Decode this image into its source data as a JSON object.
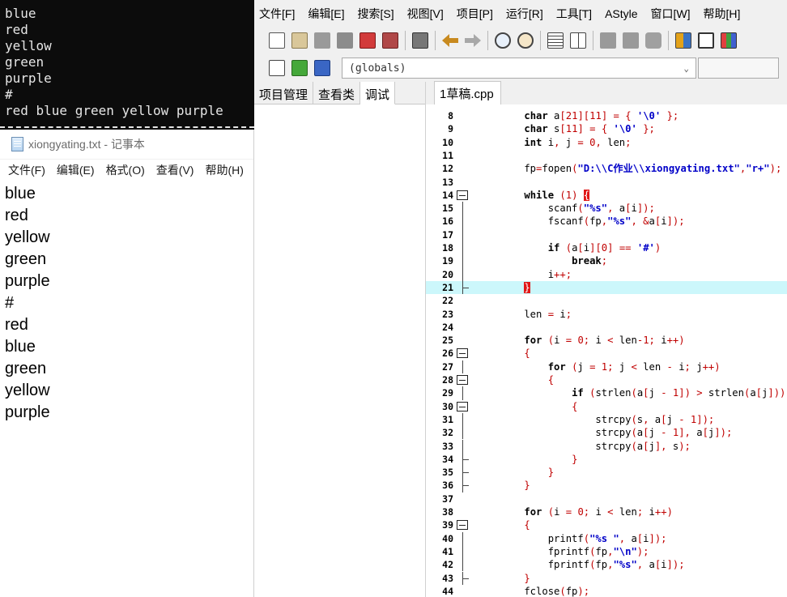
{
  "console": {
    "lines": [
      "blue",
      "red",
      "yellow",
      "green",
      "purple",
      "#",
      "red blue green yellow purple"
    ]
  },
  "notepad": {
    "title": "xiongyating.txt - 记事本",
    "menu": [
      "文件(F)",
      "编辑(E)",
      "格式(O)",
      "查看(V)",
      "帮助(H)"
    ],
    "lines": [
      "blue",
      "red",
      "yellow",
      "green",
      "purple",
      "#",
      "red",
      "blue",
      "green",
      "yellow",
      "purple"
    ]
  },
  "ide": {
    "menu": [
      "文件[F]",
      "编辑[E]",
      "搜索[S]",
      "视图[V]",
      "项目[P]",
      "运行[R]",
      "工具[T]",
      "AStyle",
      "窗口[W]",
      "帮助[H]"
    ],
    "scope": "(globals)",
    "left_tabs": [
      "项目管理",
      "查看类",
      "调试"
    ],
    "editor_tab": "1草稿.cpp",
    "highlight_color": "#ccf7fb",
    "line_numbers": [
      "8",
      "9",
      "10",
      "11",
      "12",
      "13",
      "14",
      "15",
      "16",
      "17",
      "18",
      "19",
      "20",
      "21",
      "22",
      "23",
      "24",
      "25",
      "26",
      "27",
      "28",
      "29",
      "30",
      "31",
      "32",
      "33",
      "34",
      "35",
      "36",
      "37",
      "38",
      "39",
      "40",
      "41",
      "42",
      "43",
      "44"
    ],
    "code_lines": [
      "    char a[21][11] = { '\\0' };",
      "    char s[11] = { '\\0' };",
      "    int i, j = 0, len;",
      "",
      "    fp=fopen(\"D:\\\\C作业\\\\xiongyating.txt\",\"r+\");",
      "",
      "    while (1) {",
      "        scanf(\"%s\", a[i]);",
      "        fscanf(fp,\"%s\", &a[i]);",
      "",
      "        if (a[i][0] == '#')",
      "            break;",
      "        i++;",
      "    }",
      "",
      "    len = i;",
      "",
      "    for (i = 0; i < len-1; i++)",
      "    {",
      "        for (j = 1; j < len - i; j++)",
      "        {",
      "            if (strlen(a[j - 1]) > strlen(a[j]))",
      "            {",
      "                strcpy(s, a[j - 1]);",
      "                strcpy(a[j - 1], a[j]);",
      "                strcpy(a[j], s);",
      "            }",
      "        }",
      "    }",
      "",
      "    for (i = 0; i < len; i++)",
      "    {",
      "        printf(\"%s \", a[i]);",
      "        fprintf(fp,\"\\n\");",
      "        fprintf(fp,\"%s\", a[i]);",
      "    }",
      "    fclose(fp);"
    ]
  }
}
